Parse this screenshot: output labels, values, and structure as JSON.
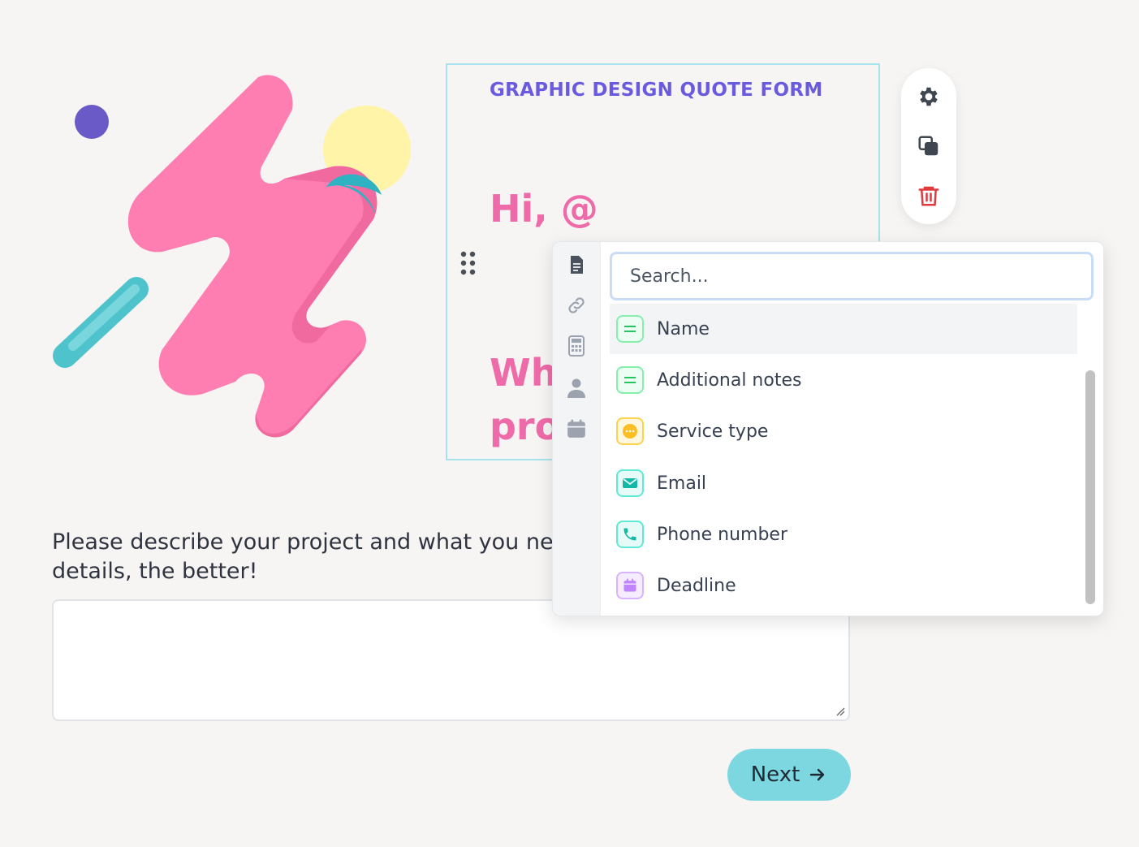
{
  "form": {
    "title": "GRAPHIC DESIGN QUOTE FORM",
    "greeting": "Hi, @",
    "question_partial": "Wh\npro",
    "description_label": "Please describe your project and what you ne\ndetails, the better!",
    "next_button": "Next"
  },
  "mention_popup": {
    "search_placeholder": "Search...",
    "categories": [
      "document-icon",
      "link-icon",
      "calculator-icon",
      "person-icon",
      "calendar-icon"
    ],
    "fields": [
      {
        "label": "Name",
        "icon": "short-text-icon",
        "color": "#22c55e"
      },
      {
        "label": "Additional notes",
        "icon": "long-text-icon",
        "color": "#22c55e"
      },
      {
        "label": "Service type",
        "icon": "choice-icon",
        "color": "#f59e0b"
      },
      {
        "label": "Email",
        "icon": "email-icon",
        "color": "#14b8a6"
      },
      {
        "label": "Phone number",
        "icon": "phone-icon",
        "color": "#14b8a6"
      },
      {
        "label": "Deadline",
        "icon": "calendar-icon",
        "color": "#a855f7"
      }
    ]
  },
  "toolbar": {
    "icons": [
      "gear-icon",
      "duplicate-icon",
      "trash-icon"
    ]
  },
  "colors": {
    "title": "#6a5ae0",
    "heading": "#ef6aa8",
    "next_button": "#7dd7e0",
    "block_border": "#a7e3ea"
  }
}
